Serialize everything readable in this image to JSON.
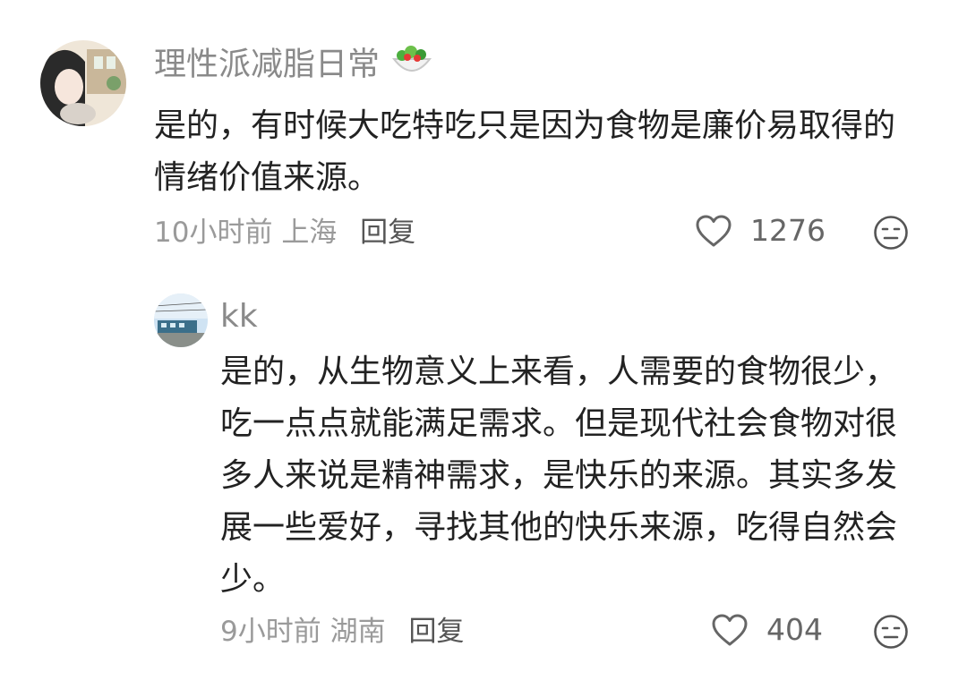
{
  "comment": {
    "username": "理性派减脂日常",
    "username_emoji": "salad-emoji-icon",
    "text": "是的，有时候大吃特吃只是因为食物是廉价易取得的情绪价值来源。",
    "time": "10小时前",
    "location": "上海",
    "reply_label": "回复",
    "likes": "1276"
  },
  "reply": {
    "username": "kk",
    "text": "是的，从生物意义上来看，人需要的食物很少，吃一点点就能满足需求。但是现代社会食物对很多人来说是精神需求，是快乐的来源。其实多发展一些爱好，寻找其他的快乐来源，吃得自然会少。",
    "time": "9小时前",
    "location": "湖南",
    "reply_label": "回复",
    "likes": "404"
  },
  "colors": {
    "username": "#8a8a8a",
    "text": "#222222",
    "meta": "#9a9a9a",
    "icon": "#555555"
  }
}
